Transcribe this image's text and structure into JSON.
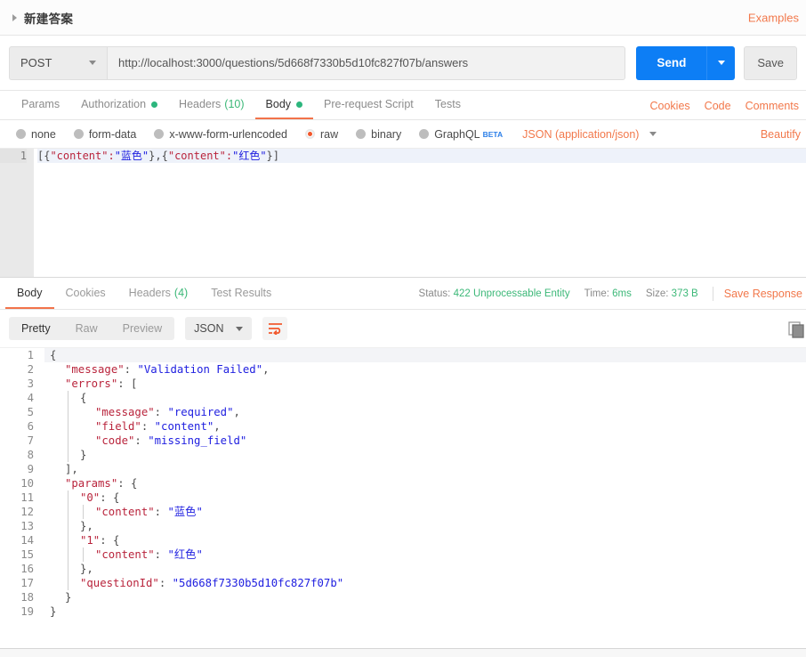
{
  "request": {
    "title": "新建答案",
    "examples_label": "Examples",
    "method": "POST",
    "url": "http://localhost:3000/questions/5d668f7330b5d10fc827f07b/answers",
    "send_label": "Send",
    "save_label": "Save",
    "tabs": [
      {
        "label": "Params",
        "dot": false,
        "count": null,
        "active": false
      },
      {
        "label": "Authorization",
        "dot": true,
        "count": null,
        "active": false
      },
      {
        "label": "Headers",
        "dot": false,
        "count": "(10)",
        "active": false
      },
      {
        "label": "Body",
        "dot": true,
        "count": null,
        "active": true
      },
      {
        "label": "Pre-request Script",
        "dot": false,
        "count": null,
        "active": false
      },
      {
        "label": "Tests",
        "dot": false,
        "count": null,
        "active": false
      }
    ],
    "tab_links": [
      "Cookies",
      "Code",
      "Comments"
    ],
    "body_types": [
      {
        "label": "none",
        "selected": false
      },
      {
        "label": "form-data",
        "selected": false
      },
      {
        "label": "x-www-form-urlencoded",
        "selected": false
      },
      {
        "label": "raw",
        "selected": true
      },
      {
        "label": "binary",
        "selected": false
      },
      {
        "label": "GraphQL",
        "selected": false,
        "badge": "BETA"
      }
    ],
    "content_type": "JSON (application/json)",
    "beautify_label": "Beautify",
    "body_lines": [
      {
        "num": "1",
        "text": "[{\"content\":\"蓝色\"},{\"content\":\"红色\"}]"
      }
    ],
    "body_raw": "[{\"content\":\"蓝色\"},{\"content\":\"红色\"}]"
  },
  "response": {
    "tabs": [
      {
        "label": "Body",
        "count": null,
        "active": true
      },
      {
        "label": "Cookies",
        "count": null,
        "active": false
      },
      {
        "label": "Headers",
        "count": "(4)",
        "active": false
      },
      {
        "label": "Test Results",
        "count": null,
        "active": false
      }
    ],
    "status_label": "Status:",
    "status_value": "422 Unprocessable Entity",
    "time_label": "Time:",
    "time_value": "6ms",
    "size_label": "Size:",
    "size_value": "373 B",
    "save_response_label": "Save Response",
    "view_modes": [
      {
        "label": "Pretty",
        "active": true
      },
      {
        "label": "Raw",
        "active": false
      },
      {
        "label": "Preview",
        "active": false
      }
    ],
    "format": "JSON",
    "wrap_icon": "word-wrap-icon",
    "copy_icon": "copy-icon",
    "body_lines": [
      {
        "num": "1",
        "indent": 0,
        "guide": 0,
        "parts": [
          {
            "t": "{",
            "c": "p"
          }
        ]
      },
      {
        "num": "2",
        "indent": 1,
        "guide": 0,
        "parts": [
          {
            "t": "\"message\"",
            "c": "k"
          },
          {
            "t": ": ",
            "c": "p"
          },
          {
            "t": "\"Validation Failed\"",
            "c": "s"
          },
          {
            "t": ",",
            "c": "p"
          }
        ]
      },
      {
        "num": "3",
        "indent": 1,
        "guide": 0,
        "parts": [
          {
            "t": "\"errors\"",
            "c": "k"
          },
          {
            "t": ": [",
            "c": "p"
          }
        ]
      },
      {
        "num": "4",
        "indent": 2,
        "guide": 1,
        "parts": [
          {
            "t": "{",
            "c": "p"
          }
        ]
      },
      {
        "num": "5",
        "indent": 3,
        "guide": 1,
        "parts": [
          {
            "t": "\"message\"",
            "c": "k"
          },
          {
            "t": ": ",
            "c": "p"
          },
          {
            "t": "\"required\"",
            "c": "s"
          },
          {
            "t": ",",
            "c": "p"
          }
        ]
      },
      {
        "num": "6",
        "indent": 3,
        "guide": 1,
        "parts": [
          {
            "t": "\"field\"",
            "c": "k"
          },
          {
            "t": ": ",
            "c": "p"
          },
          {
            "t": "\"content\"",
            "c": "s"
          },
          {
            "t": ",",
            "c": "p"
          }
        ]
      },
      {
        "num": "7",
        "indent": 3,
        "guide": 1,
        "parts": [
          {
            "t": "\"code\"",
            "c": "k"
          },
          {
            "t": ": ",
            "c": "p"
          },
          {
            "t": "\"missing_field\"",
            "c": "s"
          }
        ]
      },
      {
        "num": "8",
        "indent": 2,
        "guide": 1,
        "parts": [
          {
            "t": "}",
            "c": "p"
          }
        ]
      },
      {
        "num": "9",
        "indent": 1,
        "guide": 0,
        "parts": [
          {
            "t": "],",
            "c": "p"
          }
        ]
      },
      {
        "num": "10",
        "indent": 1,
        "guide": 0,
        "parts": [
          {
            "t": "\"params\"",
            "c": "k"
          },
          {
            "t": ": {",
            "c": "p"
          }
        ]
      },
      {
        "num": "11",
        "indent": 2,
        "guide": 1,
        "parts": [
          {
            "t": "\"0\"",
            "c": "k"
          },
          {
            "t": ": {",
            "c": "p"
          }
        ]
      },
      {
        "num": "12",
        "indent": 3,
        "guide": 2,
        "parts": [
          {
            "t": "\"content\"",
            "c": "k"
          },
          {
            "t": ": ",
            "c": "p"
          },
          {
            "t": "\"蓝色\"",
            "c": "s"
          }
        ]
      },
      {
        "num": "13",
        "indent": 2,
        "guide": 1,
        "parts": [
          {
            "t": "},",
            "c": "p"
          }
        ]
      },
      {
        "num": "14",
        "indent": 2,
        "guide": 1,
        "parts": [
          {
            "t": "\"1\"",
            "c": "k"
          },
          {
            "t": ": {",
            "c": "p"
          }
        ]
      },
      {
        "num": "15",
        "indent": 3,
        "guide": 2,
        "parts": [
          {
            "t": "\"content\"",
            "c": "k"
          },
          {
            "t": ": ",
            "c": "p"
          },
          {
            "t": "\"红色\"",
            "c": "s"
          }
        ]
      },
      {
        "num": "16",
        "indent": 2,
        "guide": 1,
        "parts": [
          {
            "t": "},",
            "c": "p"
          }
        ]
      },
      {
        "num": "17",
        "indent": 2,
        "guide": 1,
        "parts": [
          {
            "t": "\"questionId\"",
            "c": "k"
          },
          {
            "t": ": ",
            "c": "p"
          },
          {
            "t": "\"5d668f7330b5d10fc827f07b\"",
            "c": "s"
          }
        ]
      },
      {
        "num": "18",
        "indent": 1,
        "guide": 0,
        "parts": [
          {
            "t": "}",
            "c": "p"
          }
        ]
      },
      {
        "num": "19",
        "indent": 0,
        "guide": 0,
        "parts": [
          {
            "t": "}",
            "c": "p"
          }
        ]
      }
    ]
  },
  "colors": {
    "accent_orange": "#f2784b",
    "send_blue": "#0d7ef5",
    "status_green": "#3cb878",
    "json_key": "#b9243c",
    "json_string": "#2020e0"
  }
}
